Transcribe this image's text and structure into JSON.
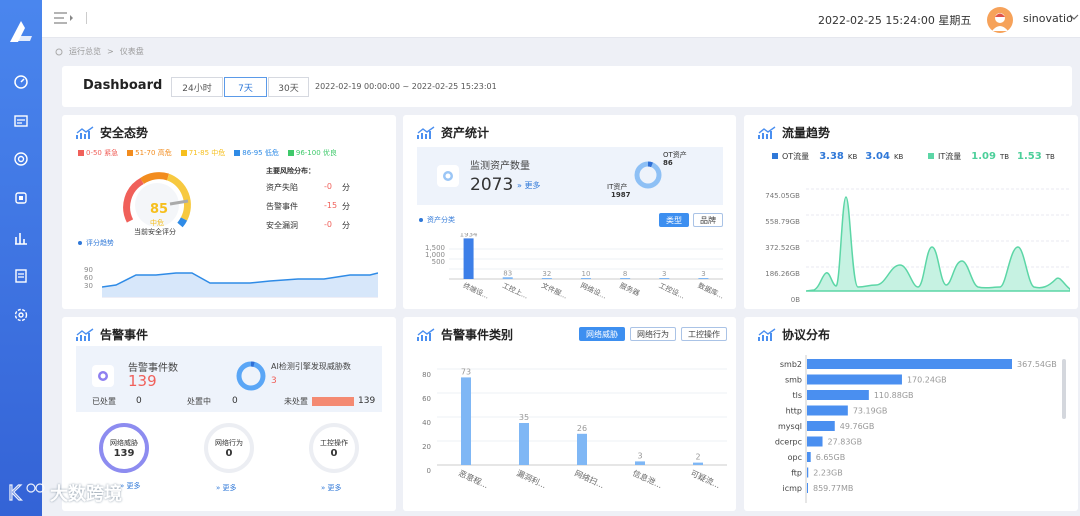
{
  "topbar": {
    "datetime": "2022-02-25 15:24:00 星期五",
    "username": "sinovatio"
  },
  "breadcrumb": {
    "root": "运行总览",
    "sep": ">",
    "current": "仪表盘"
  },
  "header": {
    "title": "Dashboard",
    "tabs": [
      "24小时",
      "7天",
      "30天"
    ],
    "active_tab": "7天",
    "range": "2022-02-19 00:00:00 ~ 2022-02-25 15:23:01"
  },
  "security": {
    "title": "安全态势",
    "legend": [
      {
        "label": "0-50 紧急",
        "color": "#f0605a"
      },
      {
        "label": "51-70 高危",
        "color": "#f28c1e"
      },
      {
        "label": "71-85 中危",
        "color": "#f6bf1e"
      },
      {
        "label": "86-95 低危",
        "color": "#2f8be6"
      },
      {
        "label": "96-100 优良",
        "color": "#3ec96a"
      }
    ],
    "score": "85",
    "level": "中危",
    "score_caption": "当前安全评分",
    "risk_title": "主要风险分布：",
    "risks": [
      {
        "label": "资产失陷",
        "value": "-0",
        "unit": "分"
      },
      {
        "label": "告警事件",
        "value": "-15",
        "unit": "分"
      },
      {
        "label": "安全漏洞",
        "value": "-0",
        "unit": "分"
      }
    ],
    "trend_label": "评分趋势",
    "trend_ticks": [
      "90",
      "60",
      "30"
    ]
  },
  "assets": {
    "title": "资产统计",
    "monitor_label": "监测资产数量",
    "monitor_value": "2073",
    "more": "更多",
    "ot_label": "OT资产",
    "ot_value": "86",
    "it_label": "IT资产",
    "it_value": "1987",
    "class_label": "资产分类",
    "btn_type": "类型",
    "btn_brand": "品牌",
    "chart_y": [
      "1,500",
      "1,000",
      "500"
    ],
    "chart_data": {
      "type": "bar",
      "categories": [
        "终端设...",
        "工控上...",
        "文件服...",
        "网络设...",
        "服务器",
        "工控设...",
        "数据库..."
      ],
      "values": [
        1934,
        83,
        32,
        10,
        8,
        3,
        3
      ],
      "ylim": [
        0,
        2000
      ]
    }
  },
  "traffic": {
    "title": "流量趋势",
    "ot_label": "OT流量",
    "ot_a": "3.38",
    "ot_a_unit": "KB",
    "ot_b": "3.04",
    "ot_b_unit": "KB",
    "it_label": "IT流量",
    "it_a": "1.09",
    "it_a_unit": "TB",
    "it_b": "1.53",
    "it_b_unit": "TB",
    "y_ticks": [
      "745.05GB",
      "558.79GB",
      "372.52GB",
      "186.26GB",
      "0B"
    ],
    "colors": {
      "ot": "#2f78d8",
      "it": "#5cd6a6"
    }
  },
  "alarms": {
    "title": "告警事件",
    "count_label": "告警事件数",
    "count_value": "139",
    "ai_label": "AI检测引擎发现威胁数",
    "ai_value": "3",
    "handled_label": "已处置",
    "handled_value": "0",
    "processing_label": "处置中",
    "processing_value": "0",
    "unhandled_label": "未处置",
    "unhandled_value": "139",
    "circles": [
      {
        "label": "网络威胁",
        "value": "139",
        "more": "更多"
      },
      {
        "label": "网络行为",
        "value": "0",
        "more": "更多"
      },
      {
        "label": "工控操作",
        "value": "0",
        "more": "更多"
      }
    ]
  },
  "alarm_types": {
    "title": "告警事件类别",
    "btns": [
      "网络威胁",
      "网络行为",
      "工控操作"
    ],
    "y_ticks": [
      "80",
      "60",
      "40",
      "20",
      "0"
    ],
    "chart_data": {
      "type": "bar",
      "categories": [
        "恶意程...",
        "漏洞利...",
        "网络扫...",
        "信息泄...",
        "可疑流..."
      ],
      "values": [
        73,
        35,
        26,
        3,
        2
      ],
      "ylim": [
        0,
        80
      ]
    }
  },
  "protocols": {
    "title": "协议分布",
    "chart_data": {
      "type": "bar",
      "categories": [
        "smb2",
        "smb",
        "tls",
        "http",
        "mysql",
        "dcerpc",
        "opc",
        "ftp",
        "icmp"
      ],
      "values": [
        367.54,
        170.24,
        110.88,
        73.19,
        49.76,
        27.83,
        6.65,
        2.23,
        0.86
      ],
      "labels": [
        "367.54GB",
        "170.24GB",
        "110.88GB",
        "73.19GB",
        "49.76GB",
        "27.83GB",
        "6.65GB",
        "2.23GB",
        "859.77MB"
      ]
    }
  },
  "watermark": "大数跨境"
}
